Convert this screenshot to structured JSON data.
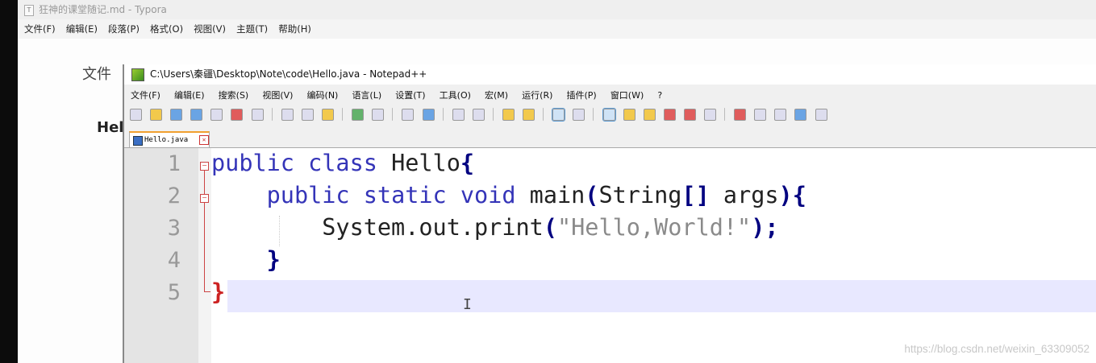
{
  "typora": {
    "title": "狂神的课堂随记.md - Typora",
    "app_icon": "T",
    "menu": [
      "文件(F)",
      "编辑(E)",
      "段落(P)",
      "格式(O)",
      "视图(V)",
      "主题(T)",
      "帮助(H)"
    ],
    "bg_heading": "文件",
    "bg_h2": "Hel"
  },
  "notepad": {
    "title": "C:\\Users\\秦疆\\Desktop\\Note\\code\\Hello.java - Notepad++",
    "menu": [
      "文件(F)",
      "编辑(E)",
      "搜索(S)",
      "视图(V)",
      "编码(N)",
      "语言(L)",
      "设置(T)",
      "工具(O)",
      "宏(M)",
      "运行(R)",
      "插件(P)",
      "窗口(W)",
      "?"
    ],
    "tab_label": "Hello.java",
    "line_numbers": [
      "1",
      "2",
      "3",
      "4",
      "5"
    ]
  },
  "watermark": "https://blog.csdn.net/weixin_63309052",
  "colors": {
    "keyword": "#3434b8",
    "brace": "#000080",
    "string": "#8a8a8a",
    "current_line": "#e8e8ff"
  }
}
